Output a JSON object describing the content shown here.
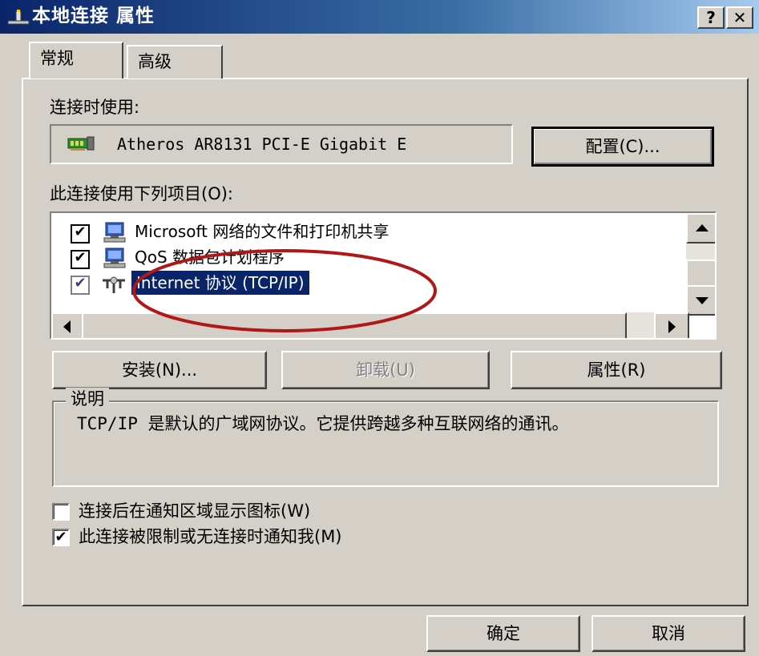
{
  "window": {
    "title": "本地连接 属性",
    "help_label": "?",
    "close_label": "✕"
  },
  "tabs": [
    {
      "label": "常规",
      "active": true
    },
    {
      "label": "高级",
      "active": false
    }
  ],
  "connect_using": {
    "label": "连接时使用:",
    "adapter_name": "Atheros AR8131 PCI-E Gigabit E",
    "configure_label": "配置(C)..."
  },
  "components": {
    "label": "此连接使用下列项目(O):",
    "items": [
      {
        "label": "Microsoft 网络的文件和打印机共享",
        "checked": true,
        "selected": false,
        "icon": "network-computer-icon"
      },
      {
        "label": "QoS 数据包计划程序",
        "checked": true,
        "selected": false,
        "icon": "network-computer-icon"
      },
      {
        "label": "Internet 协议 (TCP/IP)",
        "checked": true,
        "selected": true,
        "icon": "protocol-icon"
      }
    ]
  },
  "buttons": {
    "install": "安装(N)...",
    "uninstall": "卸载(U)",
    "properties": "属性(R)",
    "ok": "确定",
    "cancel": "取消"
  },
  "description": {
    "legend": "说明",
    "text": "TCP/IP 是默认的广域网协议。它提供跨越多种互联网络的通讯。"
  },
  "options": {
    "show_icon": {
      "label": "连接后在通知区域显示图标(W)",
      "checked": false
    },
    "notify_limited": {
      "label": "此连接被限制或无连接时通知我(M)",
      "checked": true
    }
  },
  "colors": {
    "title_bar": "#0a246a",
    "selection": "#0a246a",
    "annotation": "#b01818"
  }
}
